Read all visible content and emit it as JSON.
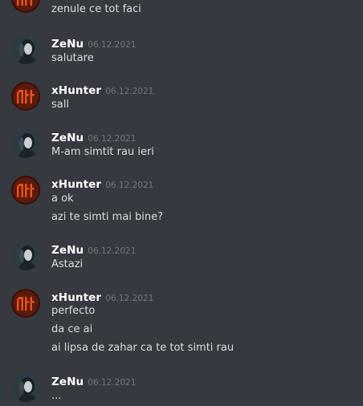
{
  "messages": [
    {
      "author": "",
      "timestamp": "",
      "avatar": "xhunter-avatar",
      "lines": [
        "zenule ce tot faci"
      ]
    },
    {
      "author": "ZeNu",
      "timestamp": "06.12.2021",
      "avatar": "zenu-avatar",
      "lines": [
        "salutare"
      ]
    },
    {
      "author": "xHunter",
      "timestamp": "06.12.2021",
      "avatar": "xhunter-avatar",
      "lines": [
        "sall"
      ]
    },
    {
      "author": "ZeNu",
      "timestamp": "06.12.2021",
      "avatar": "zenu-avatar",
      "lines": [
        "M-am simtit rau ieri"
      ]
    },
    {
      "author": "xHunter",
      "timestamp": "06.12.2021",
      "avatar": "xhunter-avatar",
      "lines": [
        "a ok",
        "azi te simti mai bine?"
      ]
    },
    {
      "author": "ZeNu",
      "timestamp": "06.12.2021",
      "avatar": "zenu-avatar",
      "lines": [
        "Astazi"
      ]
    },
    {
      "author": "xHunter",
      "timestamp": "06.12.2021",
      "avatar": "xhunter-avatar",
      "lines": [
        "perfecto",
        "da ce ai",
        "ai lipsa de zahar ca te tot simti rau"
      ]
    },
    {
      "author": "ZeNu",
      "timestamp": "06.12.2021",
      "avatar": "zenu-avatar",
      "lines": [
        "..."
      ]
    }
  ],
  "colors": {
    "background": "#36393f",
    "author": "#ffffff",
    "timestamp": "#72767d",
    "text": "#dcddde",
    "xhunter_avatar_bg": "#3a0e08",
    "xhunter_avatar_glyph": "#e8521c",
    "zenu_avatar_bg": "#2f3b44"
  }
}
